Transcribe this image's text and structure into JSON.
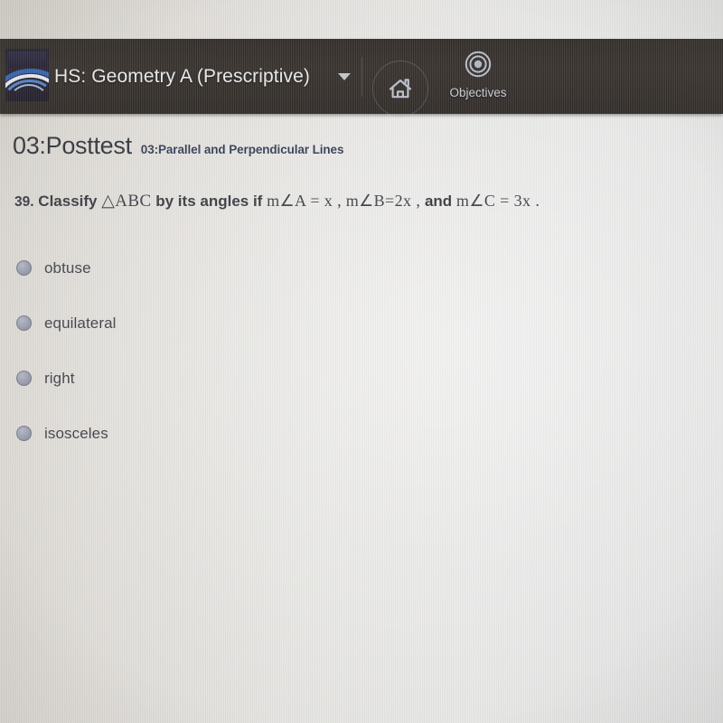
{
  "topbar": {
    "logo_icon": "lms-arch-logo",
    "course_title": "HS: Geometry A (Prescriptive)",
    "course_dropdown_icon": "chevron-down-icon",
    "home_icon": "home-icon",
    "objectives_icon": "target-icon",
    "objectives_label": "Objectives",
    "bar_color": "#2e2824",
    "text_color": "#e9e9ea"
  },
  "heading": {
    "title": "03:Posttest",
    "subtitle": "03:Parallel and Perpendicular Lines",
    "title_color": "#2e3137",
    "subtitle_color": "#2f3a52"
  },
  "question": {
    "number": "39.",
    "text_before": "Classify",
    "triangle": "△ABC",
    "text_middle": "by its angles if",
    "expr_a": "m∠A = x ,",
    "expr_b": "m∠B=2x ,",
    "conjunction": "and",
    "expr_c": "m∠C = 3x ."
  },
  "options": [
    {
      "label": "obtuse",
      "selected": false,
      "radio_icon": "radio-unselected-icon"
    },
    {
      "label": "equilateral",
      "selected": false,
      "radio_icon": "radio-unselected-icon"
    },
    {
      "label": "right",
      "selected": false,
      "radio_icon": "radio-unselected-icon"
    },
    {
      "label": "isosceles",
      "selected": false,
      "radio_icon": "radio-unselected-icon"
    }
  ],
  "page": {
    "background_color": "#dedede"
  }
}
